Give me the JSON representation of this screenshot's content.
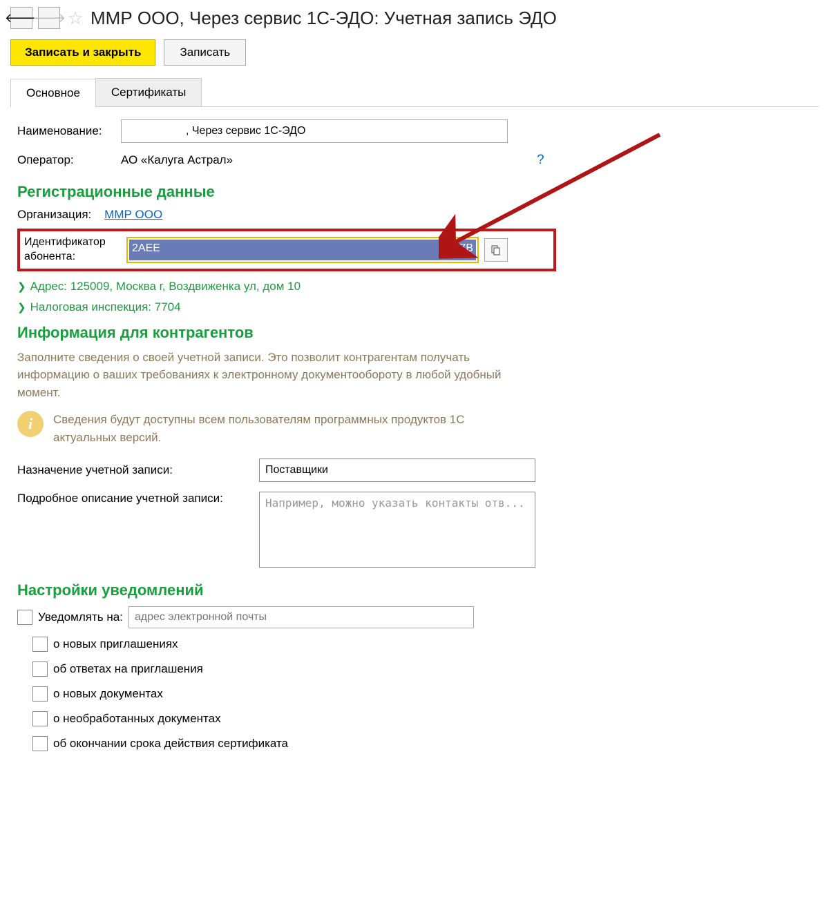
{
  "header": {
    "title": "ММР ООО, Через сервис 1С-ЭДО: Учетная запись ЭДО"
  },
  "toolbar": {
    "save_close_label": "Записать и закрыть",
    "save_label": "Записать"
  },
  "tabs": {
    "main": "Основное",
    "certs": "Сертификаты"
  },
  "main": {
    "name_label": "Наименование:",
    "name_value_tail": ", Через сервис 1С-ЭДО",
    "operator_label": "Оператор:",
    "operator_value": "АО «Калуга Астрал»",
    "help_mark": "?",
    "reg_header": "Регистрационные данные",
    "org_label": "Организация:",
    "org_link": "ММР ООО",
    "id_label": "Идентификатор абонента:",
    "id_value_left": "2AEE",
    "id_value_right": "5757B",
    "address_line": "Адрес: 125009, Москва г, Воздвиженка ул, дом 10",
    "tax_line": "Налоговая инспекция: 7704",
    "info_header": "Информация для контрагентов",
    "info_desc": "Заполните сведения о своей учетной записи. Это позволит контрагентам получать информацию о ваших требованиях к электронному документообороту в любой удобный момент.",
    "info_banner": "Сведения будут доступны всем пользователям программных продуктов 1С актуальных версий.",
    "assign_label": "Назначение учетной записи:",
    "assign_value": "Поставщики",
    "desc_label": "Подробное описание учетной записи:",
    "desc_placeholder": "Например, можно указать контакты отв...",
    "notify_header": "Настройки уведомлений",
    "notify_on_label": "Уведомлять на:",
    "notify_email_placeholder": "адрес электронной почты",
    "sub_checks": [
      "о новых приглашениях",
      "об ответах на приглашения",
      "о новых документах",
      "о необработанных документах",
      "об окончании срока действия сертификата"
    ]
  }
}
